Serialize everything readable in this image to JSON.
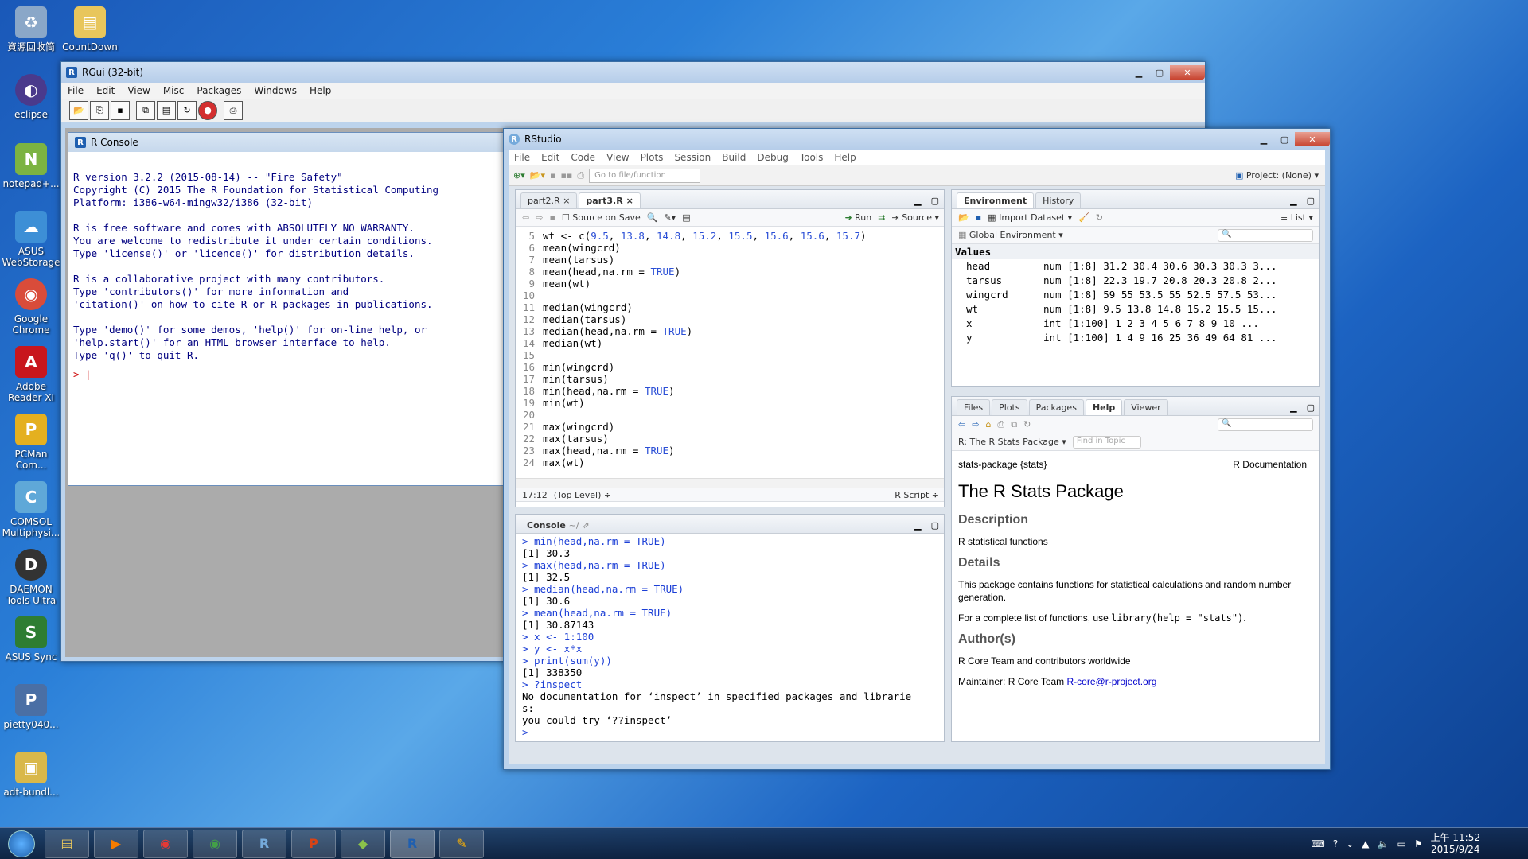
{
  "desktop": {
    "icons": [
      {
        "label": "資源回收筒",
        "glyph": "♻"
      },
      {
        "label": "eclipse",
        "glyph": "◐"
      },
      {
        "label": "notepad+...",
        "glyph": "N"
      },
      {
        "label": "ASUS WebStorage",
        "glyph": "☁"
      },
      {
        "label": "Google Chrome",
        "glyph": "◉"
      },
      {
        "label": "Adobe Reader XI",
        "glyph": "A"
      },
      {
        "label": "PCMan Com...",
        "glyph": "P"
      },
      {
        "label": "COMSOL Multiphysi...",
        "glyph": "C"
      },
      {
        "label": "DAEMON Tools Ultra",
        "glyph": "D"
      },
      {
        "label": "ASUS Sync",
        "glyph": "S"
      },
      {
        "label": "pietty040...",
        "glyph": "P"
      },
      {
        "label": "adt-bundl...",
        "glyph": "▣"
      }
    ],
    "top_icon": {
      "label": "CountDown",
      "glyph": "▤"
    }
  },
  "rgui": {
    "title": "RGui (32-bit)",
    "menu": [
      "File",
      "Edit",
      "View",
      "Misc",
      "Packages",
      "Windows",
      "Help"
    ],
    "console_title": "R Console",
    "console_text": "\nR version 3.2.2 (2015-08-14) -- \"Fire Safety\"\nCopyright (C) 2015 The R Foundation for Statistical Computing\nPlatform: i386-w64-mingw32/i386 (32-bit)\n\nR is free software and comes with ABSOLUTELY NO WARRANTY.\nYou are welcome to redistribute it under certain conditions.\nType 'license()' or 'licence()' for distribution details.\n\nR is a collaborative project with many contributors.\nType 'contributors()' for more information and\n'citation()' on how to cite R or R packages in publications.\n\nType 'demo()' for some demos, 'help()' for on-line help, or\n'help.start()' for an HTML browser interface to help.\nType 'q()' to quit R.\n",
    "prompt": ">"
  },
  "rstudio": {
    "title": "RStudio",
    "menu": [
      "File",
      "Edit",
      "Code",
      "View",
      "Plots",
      "Session",
      "Build",
      "Debug",
      "Tools",
      "Help"
    ],
    "goto_placeholder": "Go to file/function",
    "project": "Project: (None)",
    "editor": {
      "tabs": [
        "part2.R",
        "part3.R"
      ],
      "source_on_save": "Source on Save",
      "run": "Run",
      "source": "Source",
      "lines": [
        {
          "n": "5",
          "code": "wt <- c(9.5, 13.8, 14.8, 15.2, 15.5, 15.6, 15.6, 15.7)"
        },
        {
          "n": "6",
          "code": "mean(wingcrd)"
        },
        {
          "n": "7",
          "code": "mean(tarsus)"
        },
        {
          "n": "8",
          "code": "mean(head,na.rm = TRUE)"
        },
        {
          "n": "9",
          "code": "mean(wt)"
        },
        {
          "n": "10",
          "code": ""
        },
        {
          "n": "11",
          "code": "median(wingcrd)"
        },
        {
          "n": "12",
          "code": "median(tarsus)"
        },
        {
          "n": "13",
          "code": "median(head,na.rm = TRUE)"
        },
        {
          "n": "14",
          "code": "median(wt)"
        },
        {
          "n": "15",
          "code": ""
        },
        {
          "n": "16",
          "code": "min(wingcrd)"
        },
        {
          "n": "17",
          "code": "min(tarsus)"
        },
        {
          "n": "18",
          "code": "min(head,na.rm = TRUE)"
        },
        {
          "n": "19",
          "code": "min(wt)"
        },
        {
          "n": "20",
          "code": ""
        },
        {
          "n": "21",
          "code": "max(wingcrd)"
        },
        {
          "n": "22",
          "code": "max(tarsus)"
        },
        {
          "n": "23",
          "code": "max(head,na.rm = TRUE)"
        },
        {
          "n": "24",
          "code": "max(wt)"
        }
      ],
      "status_pos": "17:12",
      "status_scope": "(Top Level) ÷",
      "status_type": "R Script ÷"
    },
    "console": {
      "title": "Console",
      "path": "~/",
      "lines": [
        {
          "t": "cmd",
          "s": "> min(head,na.rm = TRUE)"
        },
        {
          "t": "out",
          "s": "[1] 30.3"
        },
        {
          "t": "cmd",
          "s": "> max(head,na.rm = TRUE)"
        },
        {
          "t": "out",
          "s": "[1] 32.5"
        },
        {
          "t": "cmd",
          "s": "> median(head,na.rm = TRUE)"
        },
        {
          "t": "out",
          "s": "[1] 30.6"
        },
        {
          "t": "cmd",
          "s": "> mean(head,na.rm = TRUE)"
        },
        {
          "t": "out",
          "s": "[1] 30.87143"
        },
        {
          "t": "cmd",
          "s": "> x <- 1:100"
        },
        {
          "t": "cmd",
          "s": "> y <- x*x"
        },
        {
          "t": "cmd",
          "s": "> print(sum(y))"
        },
        {
          "t": "out",
          "s": "[1] 338350"
        },
        {
          "t": "cmd",
          "s": "> ?inspect"
        },
        {
          "t": "out",
          "s": "No documentation for ‘inspect’ in specified packages and librarie"
        },
        {
          "t": "out",
          "s": "s:"
        },
        {
          "t": "out",
          "s": "you could try ‘??inspect’"
        },
        {
          "t": "cmd",
          "s": "> "
        }
      ]
    },
    "env": {
      "tabs": [
        "Environment",
        "History"
      ],
      "import": "Import Dataset",
      "list": "List",
      "scope": "Global Environment",
      "section": "Values",
      "rows": [
        {
          "name": "head",
          "value": "num [1:8] 31.2 30.4 30.6 30.3 30.3 3..."
        },
        {
          "name": "tarsus",
          "value": "num [1:8] 22.3 19.7 20.8 20.3 20.8 2..."
        },
        {
          "name": "wingcrd",
          "value": "num [1:8] 59 55 53.5 55 52.5 57.5 53..."
        },
        {
          "name": "wt",
          "value": "num [1:8] 9.5 13.8 14.8 15.2 15.5 15..."
        },
        {
          "name": "x",
          "value": "int [1:100] 1 2 3 4 5 6 7 8 9 10 ..."
        },
        {
          "name": "y",
          "value": "int [1:100] 1 4 9 16 25 36 49 64 81 ..."
        }
      ]
    },
    "help": {
      "tabs": [
        "Files",
        "Plots",
        "Packages",
        "Help",
        "Viewer"
      ],
      "topic": "R: The R Stats Package",
      "find_placeholder": "Find in Topic",
      "header_left": "stats-package {stats}",
      "header_right": "R Documentation",
      "h1": "The R Stats Package",
      "desc_h": "Description",
      "desc": "R statistical functions",
      "details_h": "Details",
      "details": "This package contains functions for statistical calculations and random number generation.",
      "details2_pre": "For a complete list of functions, use",
      "details2_code": "library(help = \"stats\")",
      "details2_post": ".",
      "authors_h": "Author(s)",
      "authors": "R Core Team and contributors worldwide",
      "maint_pre": "Maintainer: R Core Team",
      "maint_link": "R-core@r-project.org"
    }
  },
  "taskbar": {
    "clock_time": "上午 11:52",
    "clock_date": "2015/9/24"
  }
}
